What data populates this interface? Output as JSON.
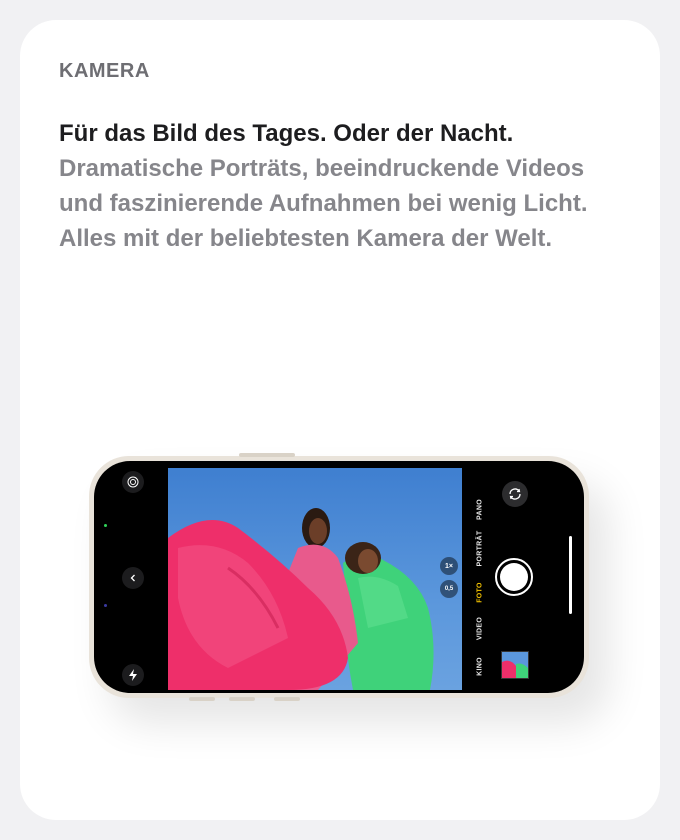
{
  "section": {
    "eyebrow": "KAMERA",
    "headline": "Für das Bild des Tages. Oder der Nacht.",
    "body": "Dramatische Porträts, beeindruckende Videos und faszinierende Aufnahmen bei wenig Licht. Alles mit der belieb­testen Kamera der Welt."
  },
  "camera_ui": {
    "modes": [
      "KINO",
      "VIDEO",
      "FOTO",
      "PORTRÄT",
      "PANO"
    ],
    "active_mode": "FOTO",
    "zoom_levels": [
      "1×",
      "0,5"
    ],
    "colors": {
      "active_mode": "#f5c400",
      "dress_pink": "#ee2f6a",
      "dress_green": "#3fd27a",
      "sky": "#4a88d2"
    }
  }
}
